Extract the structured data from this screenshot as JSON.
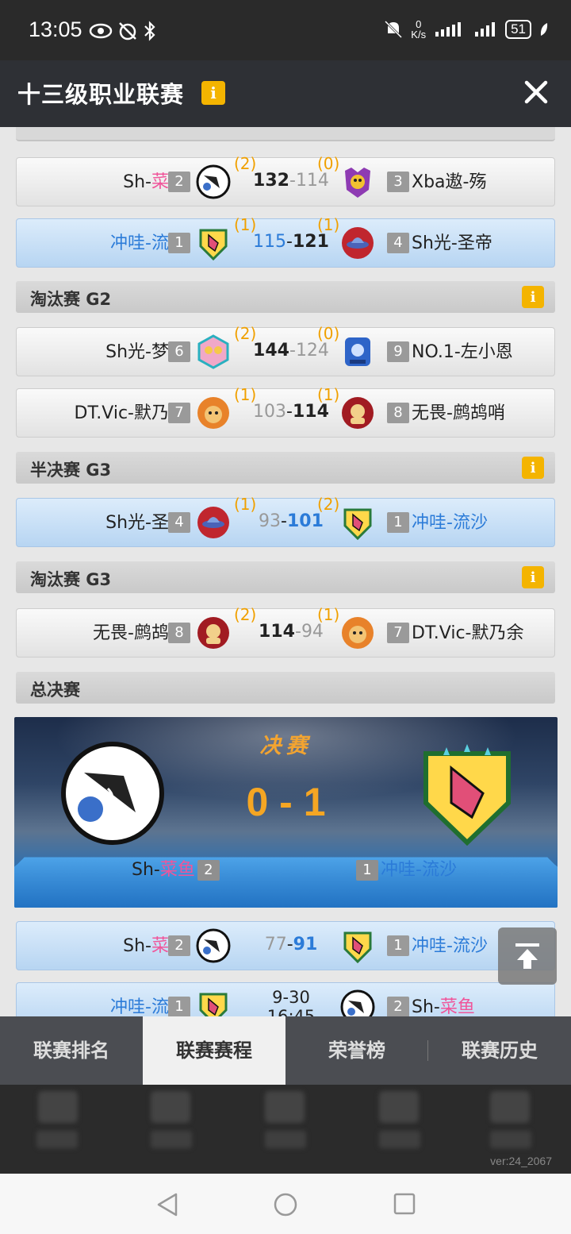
{
  "status_bar": {
    "time": "13:05",
    "net_speed_value": "0",
    "net_speed_unit": "K/s",
    "battery": "51"
  },
  "header": {
    "title": "十三级职业联赛",
    "info_glyph": "i"
  },
  "schedule": {
    "round1": [
      {
        "left_name_prefix": "Sh-",
        "left_name_suffix": "菜鱼",
        "left_seed": "2",
        "left_wins": "(2)",
        "left_score": "132",
        "sep": "-",
        "right_score": "114",
        "right_wins": "(0)",
        "right_seed": "3",
        "right_name": "Xba遨-殇",
        "highlight": false
      },
      {
        "left_name": "冲哇-流沙",
        "left_seed": "1",
        "left_wins": "(1)",
        "left_score": "115",
        "sep": "-",
        "right_score": "121",
        "right_wins": "(1)",
        "right_seed": "4",
        "right_name": "Sh光-圣帝",
        "highlight": true
      }
    ],
    "section_elim_g2": "淘汰赛 G2",
    "elim_g2": [
      {
        "left_name": "Sh光-梦梦",
        "left_seed": "6",
        "left_wins": "(2)",
        "left_score": "144",
        "sep": "-",
        "right_score": "124",
        "right_wins": "(0)",
        "right_seed": "9",
        "right_name": "NO.1-左小恩"
      },
      {
        "left_name": "DT.Vic-默乃余",
        "left_seed": "7",
        "left_wins": "(1)",
        "left_score": "103",
        "sep": "-",
        "right_score": "114",
        "right_wins": "(1)",
        "right_seed": "8",
        "right_name": "无畏-鹧鸪哨"
      }
    ],
    "section_semi_g3": "半决赛 G3",
    "semi_g3": {
      "left_name": "Sh光-圣帝",
      "left_seed": "4",
      "left_wins": "(1)",
      "left_score": "93",
      "sep": "-",
      "right_score": "101",
      "right_wins": "(2)",
      "right_seed": "1",
      "right_name": "冲哇-流沙"
    },
    "section_elim_g3": "淘汰赛 G3",
    "elim_g3": {
      "left_name": "无畏-鹧鸪哨",
      "left_seed": "8",
      "left_wins": "(2)",
      "left_score": "114",
      "sep": "-",
      "right_score": "94",
      "right_wins": "(1)",
      "right_seed": "7",
      "right_name": "DT.Vic-默乃余"
    },
    "section_final": "总决赛",
    "final_banner": {
      "label": "决赛",
      "score": "0 - 1",
      "left_name_prefix": "Sh-",
      "left_name_suffix": "菜鱼",
      "left_seed": "2",
      "right_seed": "1",
      "right_name": "冲哇-流沙"
    },
    "final_games": [
      {
        "left_name_prefix": "Sh-",
        "left_name_suffix": "菜鱼",
        "left_seed": "2",
        "left_score": "77",
        "sep": "-",
        "right_score": "91",
        "right_seed": "1",
        "right_name": "冲哇-流沙"
      },
      {
        "left_name": "冲哇-流沙",
        "left_seed": "1",
        "date": "9-30",
        "time": "16:45",
        "right_seed": "2",
        "right_name_prefix": "Sh-",
        "right_name_suffix": "菜鱼"
      }
    ]
  },
  "tabs": [
    {
      "label": "联赛排名",
      "active": false
    },
    {
      "label": "联赛赛程",
      "active": true
    },
    {
      "label": "荣誉榜",
      "active": false
    },
    {
      "label": "联赛历史",
      "active": false
    }
  ],
  "version": "ver:24_2067",
  "colors": {
    "accent_orange": "#f0a000",
    "team_blue": "#2b7bd8",
    "name_pink": "#f0559a",
    "info_yellow": "#f4b400"
  }
}
